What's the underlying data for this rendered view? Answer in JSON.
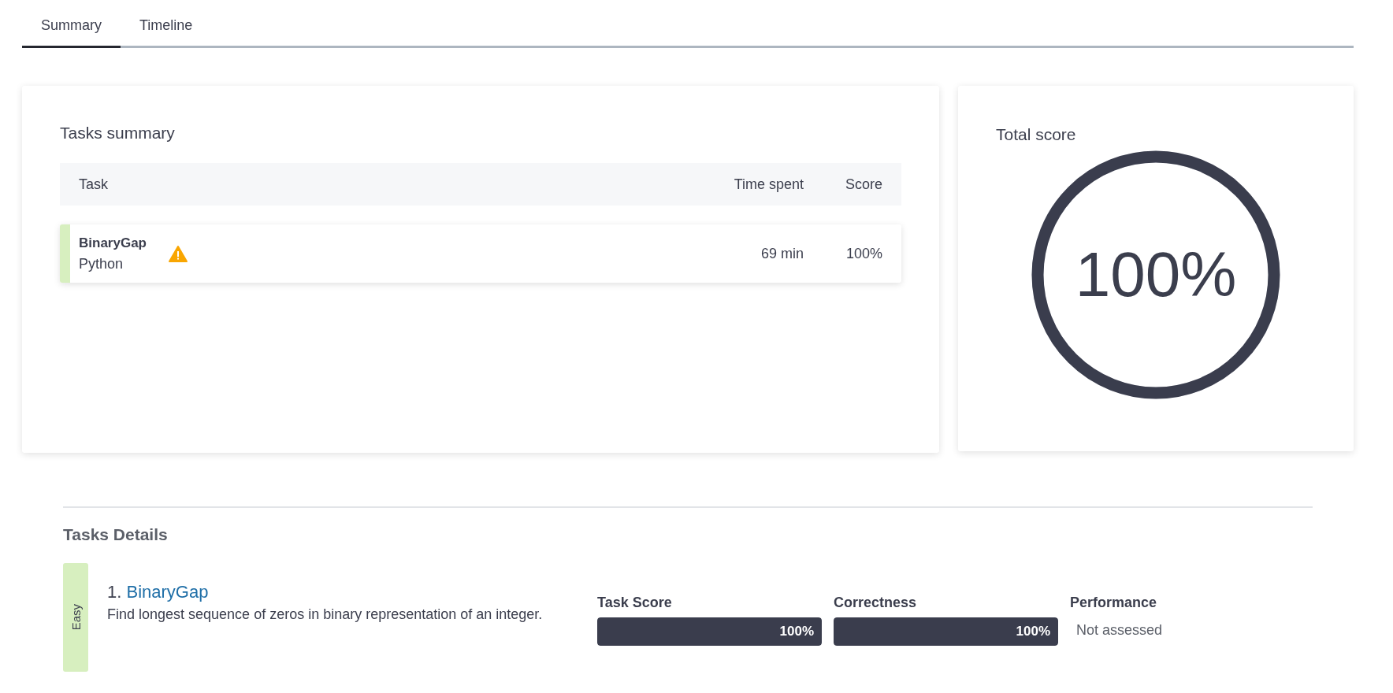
{
  "tabs": [
    {
      "label": "Summary",
      "selected": true
    },
    {
      "label": "Timeline",
      "selected": false
    }
  ],
  "tasks_summary": {
    "title": "Tasks summary",
    "columns": [
      "Task",
      "Time spent",
      "Score"
    ],
    "rows": [
      {
        "task": "BinaryGap",
        "language": "Python",
        "warning": true,
        "time_spent": "69 min",
        "score": "100%"
      }
    ]
  },
  "total_score": {
    "title": "Total score",
    "value": "100%",
    "level": 1
  },
  "tasks_details": {
    "title": "Tasks Details",
    "tasks": [
      {
        "difficulty": "Easy",
        "number": "1.",
        "name": "BinaryGap",
        "description": "Find longest sequence of zeros in binary representation of an integer.",
        "metrics": [
          {
            "kind": "bar",
            "label": "Task Score",
            "value": "100%",
            "level": 1
          },
          {
            "kind": "bar",
            "label": "Correctness",
            "value": "100%",
            "level": 1
          },
          {
            "kind": "text",
            "label": "Performance",
            "value": "Not assessed"
          }
        ]
      }
    ]
  }
}
